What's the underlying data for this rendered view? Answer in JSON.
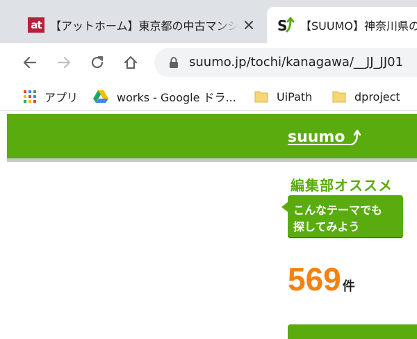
{
  "tabs": [
    {
      "title": "【アットホーム】東京都の中古マンション",
      "favicon": "athome-favicon",
      "favicon_text": "at",
      "active": false
    },
    {
      "title": "【SUUMO】神奈川県の",
      "favicon": "suumo-favicon",
      "active": true
    }
  ],
  "toolbar": {
    "back": "back-arrow-icon",
    "forward": "forward-arrow-icon",
    "reload": "reload-icon",
    "home": "home-icon",
    "url": "suumo.jp/tochi/kanagawa/__JJ_JJ01"
  },
  "bookmarks": [
    {
      "label": "アプリ",
      "icon": "apps-grid-icon"
    },
    {
      "label": "works - Google ドラ...",
      "icon": "google-drive-icon"
    },
    {
      "label": "UiPath",
      "icon": "folder-icon"
    },
    {
      "label": "dproject",
      "icon": "folder-icon"
    }
  ],
  "page": {
    "logo_text": "suumo",
    "promo_title": "編集部オススメ",
    "promo_line1": "こんなテーマでも",
    "promo_line2": "探してみよう",
    "count": "569",
    "count_unit": "件"
  },
  "colors": {
    "suumo_green": "#5aac0e",
    "count_orange": "#f5820f",
    "athome_red": "#b5213a"
  }
}
